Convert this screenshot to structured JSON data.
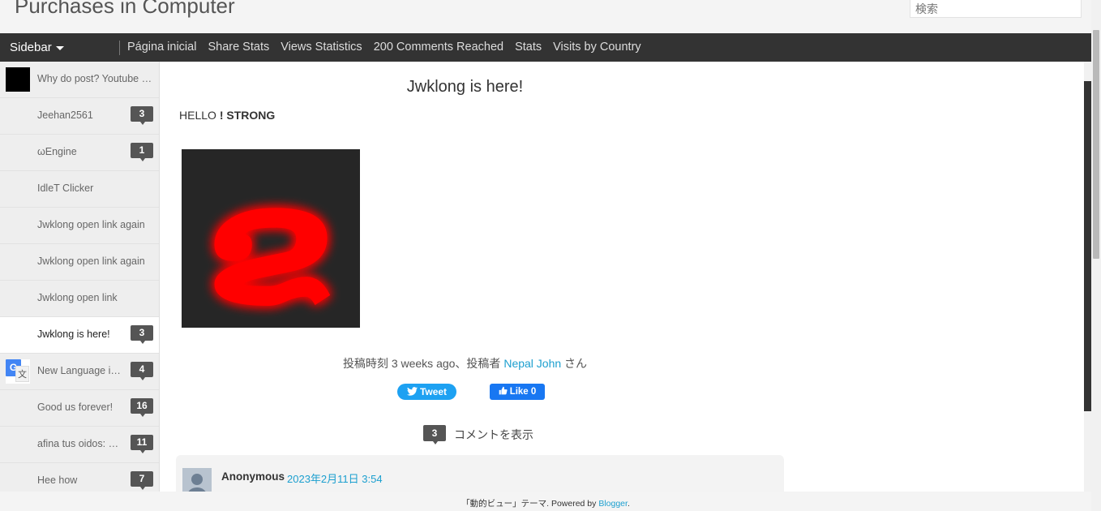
{
  "header": {
    "blog_title": "Purchases in Computer",
    "search_placeholder": "検索"
  },
  "nav": {
    "sidebar_toggle_label": "Sidebar",
    "links": [
      "Página inicial",
      "Share Stats",
      "Views Statistics",
      "200 Comments Reached",
      "Stats",
      "Visits by Country"
    ]
  },
  "sidebar": {
    "items": [
      {
        "title": "Why do post? Youtube c...",
        "comments": "",
        "thumb": "black-square"
      },
      {
        "title": "Jeehan2561",
        "comments": "3",
        "thumb": ""
      },
      {
        "title": "ωEngine",
        "comments": "1",
        "thumb": ""
      },
      {
        "title": "IdleT Clicker",
        "comments": "",
        "thumb": ""
      },
      {
        "title": "Jwklong open link again",
        "comments": "",
        "thumb": ""
      },
      {
        "title": "Jwklong open link again",
        "comments": "",
        "thumb": ""
      },
      {
        "title": "Jwklong open link",
        "comments": "",
        "thumb": ""
      },
      {
        "title": "Jwklong is here!",
        "comments": "3",
        "thumb": "",
        "active": true
      },
      {
        "title": "New Language in...",
        "comments": "4",
        "thumb": "google-translate-icon"
      },
      {
        "title": "Good us forever!",
        "comments": "16",
        "thumb": ""
      },
      {
        "title": "afina tus oidos: W...",
        "comments": "11",
        "thumb": ""
      },
      {
        "title": "Hee how",
        "comments": "7",
        "thumb": ""
      }
    ]
  },
  "post": {
    "title": "Jwklong is here!",
    "body_text": "HELLO",
    "body_strong": "! STRONG",
    "image_glyph": "ຂ",
    "meta_prefix": "投稿時刻 3 weeks ago、投稿者",
    "author": "Nepal John",
    "meta_suffix": "さん",
    "tweet_label": "Tweet",
    "like_label": "Like 0",
    "comments_count": "3",
    "comments_label": "コメントを表示"
  },
  "comment": {
    "author": "Anonymous",
    "date": "2023年2月11日 3:54"
  },
  "footer": {
    "text": "「動的ビュー」テーマ. Powered by",
    "link": "Blogger",
    "period": "."
  },
  "colors": {
    "navbar": "#333333",
    "link": "#1b9fcf",
    "tweet": "#1da1f2",
    "like": "#1877f2",
    "badge": "#555555",
    "glow": "#ff0000"
  }
}
